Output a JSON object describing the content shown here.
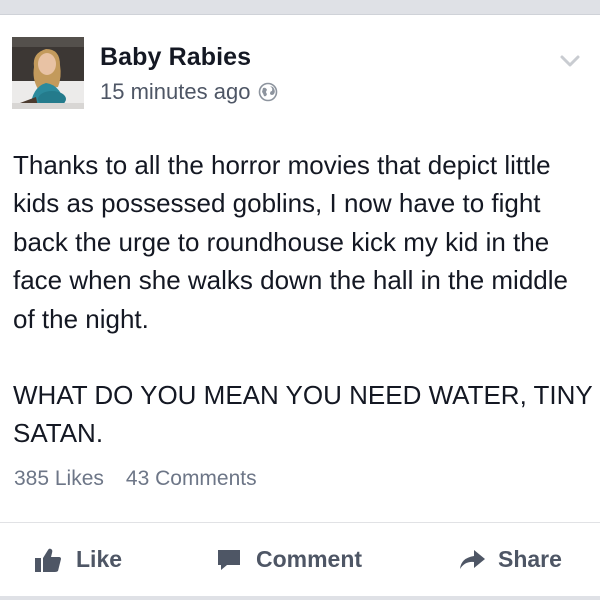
{
  "post": {
    "author": "Baby Rabies",
    "timestamp": "15 minutes ago",
    "privacy_icon": "globe-icon",
    "options_icon": "chevron-down-icon",
    "body": [
      "Thanks to all the horror movies that depict little kids as possessed goblins, I now have to fight back the urge to roundhouse kick my kid in the face when she walks down the hall in the middle of the night.",
      "WHAT DO YOU MEAN YOU NEED WATER, TINY SATAN."
    ],
    "likes": "385 Likes",
    "comments": "43 Comments"
  },
  "actions": {
    "like": {
      "label": "Like",
      "icon": "thumbs-up-icon"
    },
    "comment": {
      "label": "Comment",
      "icon": "speech-bubble-icon"
    },
    "share": {
      "label": "Share",
      "icon": "share-arrow-icon"
    }
  },
  "colors": {
    "text": "#141823",
    "secondary": "#4e5665",
    "muted": "#6d7687",
    "background": "#dfe1e6"
  }
}
